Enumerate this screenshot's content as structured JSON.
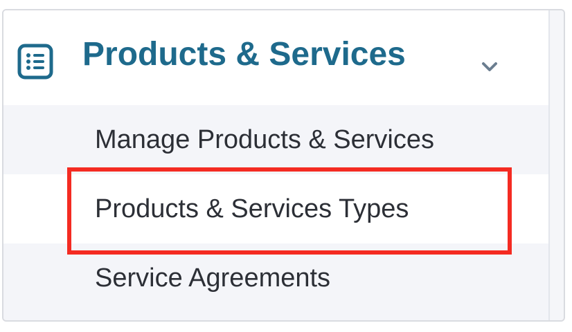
{
  "menu": {
    "title": "Products & Services",
    "icon": "list-icon",
    "expand_icon": "chevron-down-icon",
    "items": [
      {
        "label": "Manage Products & Services"
      },
      {
        "label": "Products & Services Types",
        "highlighted": true
      },
      {
        "label": "Service Agreements"
      }
    ]
  },
  "colors": {
    "title": "#1e6a8c",
    "highlight_border": "#f42b22",
    "item_text": "#2c2f36",
    "chevron": "#6b7e90"
  }
}
